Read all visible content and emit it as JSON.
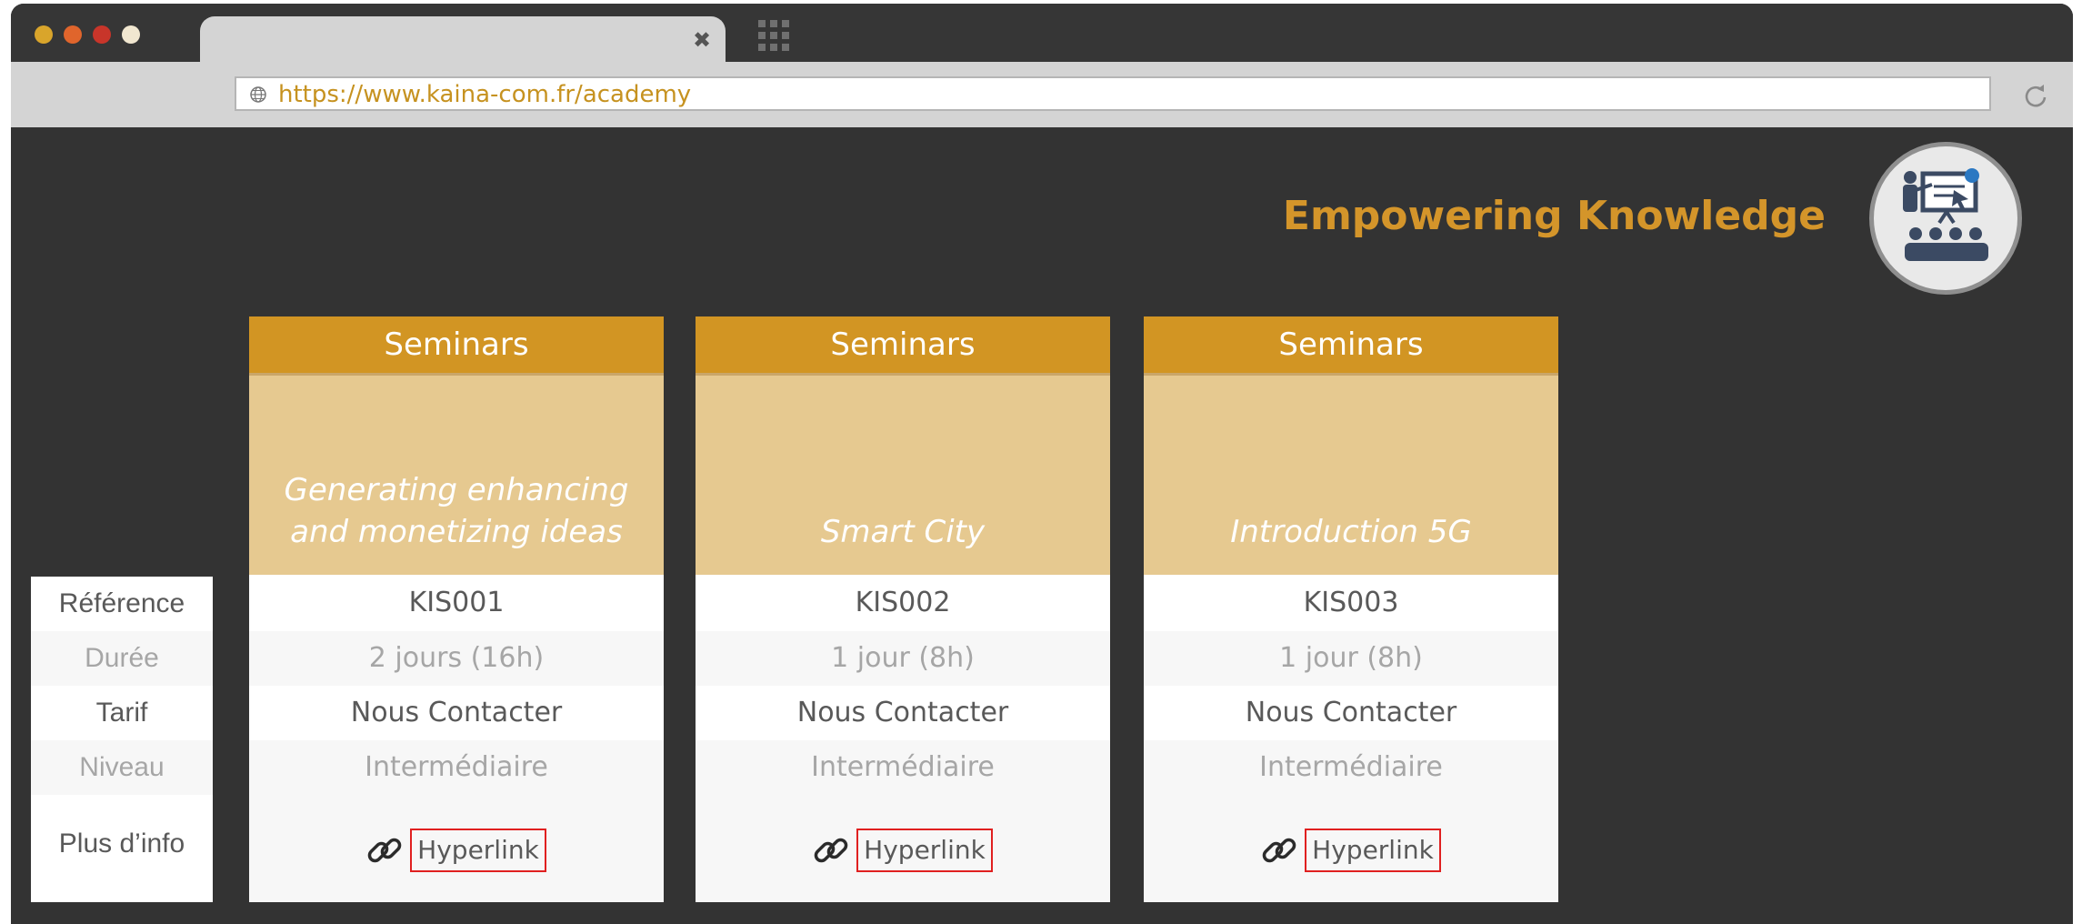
{
  "browser": {
    "url": "https://www.kaina-com.fr/academy",
    "traffic_light_colors": [
      "#d9a52b",
      "#e0652c",
      "#c8352a",
      "#f1e7d0"
    ]
  },
  "hero": {
    "headline": "Empowering Knowledge",
    "logo_icon": "presentation-audience-icon"
  },
  "row_labels": [
    "Référence",
    "Durée",
    "Tarif",
    "Niveau",
    "Plus d’info"
  ],
  "cards": [
    {
      "category": "Seminars",
      "title": "Generating enhancing and monetizing ideas",
      "reference": "KIS001",
      "duration": "2 jours (16h)",
      "price": "Nous Contacter",
      "level": "Intermédiaire",
      "link_label": "Hyperlink"
    },
    {
      "category": "Seminars",
      "title": "Smart City",
      "reference": "KIS002",
      "duration": "1 jour (8h)",
      "price": "Nous Contacter",
      "level": "Intermédiaire",
      "link_label": "Hyperlink"
    },
    {
      "category": "Seminars",
      "title": "Introduction 5G",
      "reference": "KIS003",
      "duration": "1 jour (8h)",
      "price": "Nous Contacter",
      "level": "Intermédiaire",
      "link_label": "Hyperlink"
    }
  ],
  "colors": {
    "accent": "#d29523",
    "title_band": "#e6c990",
    "background": "#333333",
    "link_border": "#e02020"
  }
}
